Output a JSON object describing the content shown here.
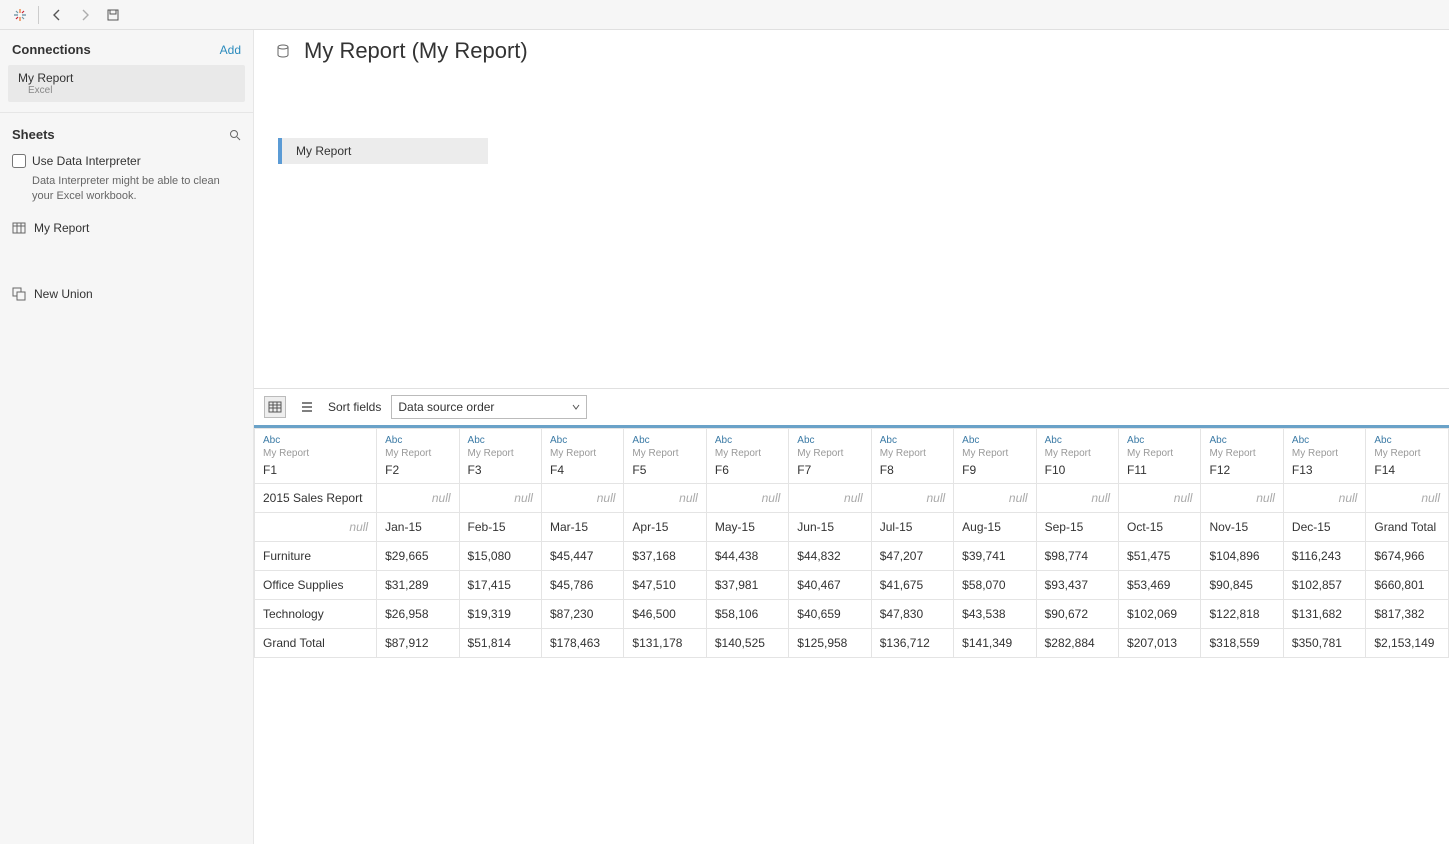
{
  "topbar": {
    "back": "←",
    "fwd": "→"
  },
  "sidebar": {
    "connections_label": "Connections",
    "add_label": "Add",
    "connection": {
      "name": "My Report",
      "type": "Excel"
    },
    "sheets_label": "Sheets",
    "use_di_label": "Use Data Interpreter",
    "di_help": "Data Interpreter might be able to clean your Excel workbook.",
    "sheet_name": "My Report",
    "new_union": "New Union"
  },
  "header": {
    "title": "My Report (My Report)",
    "pill": "My Report"
  },
  "toolbar": {
    "sort_label": "Sort fields",
    "sort_value": "Data source order"
  },
  "grid": {
    "type_label": "Abc",
    "src_label": "My Report",
    "columns": [
      "F1",
      "F2",
      "F3",
      "F4",
      "F5",
      "F6",
      "F7",
      "F8",
      "F9",
      "F10",
      "F11",
      "F12",
      "F13",
      "F14"
    ],
    "rows": [
      [
        "2015 Sales Report",
        "null",
        "null",
        "null",
        "null",
        "null",
        "null",
        "null",
        "null",
        "null",
        "null",
        "null",
        "null",
        "null"
      ],
      [
        "null",
        "Jan-15",
        "Feb-15",
        "Mar-15",
        "Apr-15",
        "May-15",
        "Jun-15",
        "Jul-15",
        "Aug-15",
        "Sep-15",
        "Oct-15",
        "Nov-15",
        "Dec-15",
        "Grand Total"
      ],
      [
        "Furniture",
        "$29,665",
        "$15,080",
        "$45,447",
        "$37,168",
        "$44,438",
        "$44,832",
        "$47,207",
        "$39,741",
        "$98,774",
        "$51,475",
        "$104,896",
        "$116,243",
        "$674,966"
      ],
      [
        "Office Supplies",
        "$31,289",
        "$17,415",
        "$45,786",
        "$47,510",
        "$37,981",
        "$40,467",
        "$41,675",
        "$58,070",
        "$93,437",
        "$53,469",
        "$90,845",
        "$102,857",
        "$660,801"
      ],
      [
        "Technology",
        "$26,958",
        "$19,319",
        "$87,230",
        "$46,500",
        "$58,106",
        "$40,659",
        "$47,830",
        "$43,538",
        "$90,672",
        "$102,069",
        "$122,818",
        "$131,682",
        "$817,382"
      ],
      [
        "Grand Total",
        "$87,912",
        "$51,814",
        "$178,463",
        "$131,178",
        "$140,525",
        "$125,958",
        "$136,712",
        "$141,349",
        "$282,884",
        "$207,013",
        "$318,559",
        "$350,781",
        "$2,153,149"
      ]
    ]
  }
}
